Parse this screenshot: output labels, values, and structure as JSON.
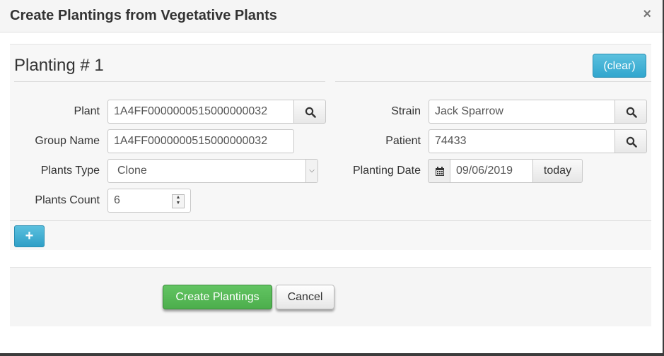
{
  "dialog": {
    "title": "Create Plantings from Vegetative Plants",
    "close_glyph": "×"
  },
  "planting": {
    "title": "Planting # 1",
    "clear_label": "(clear)",
    "plant_label": "Plant",
    "plant_value": "1A4FF0000000515000000032",
    "group_name_label": "Group Name",
    "group_name_value": "1A4FF0000000515000000032",
    "plants_type_label": "Plants Type",
    "plants_type_value": "Clone",
    "plants_count_label": "Plants Count",
    "plants_count_value": "6",
    "strain_label": "Strain",
    "strain_value": "Jack Sparrow",
    "patient_label": "Patient",
    "patient_value": "74433",
    "planting_date_label": "Planting Date",
    "planting_date_value": "09/06/2019",
    "today_label": "today",
    "add_label": "+"
  },
  "footer": {
    "create_label": "Create Plantings",
    "cancel_label": "Cancel"
  },
  "colors": {
    "info": "#5bc0de",
    "success": "#5cb85c"
  }
}
